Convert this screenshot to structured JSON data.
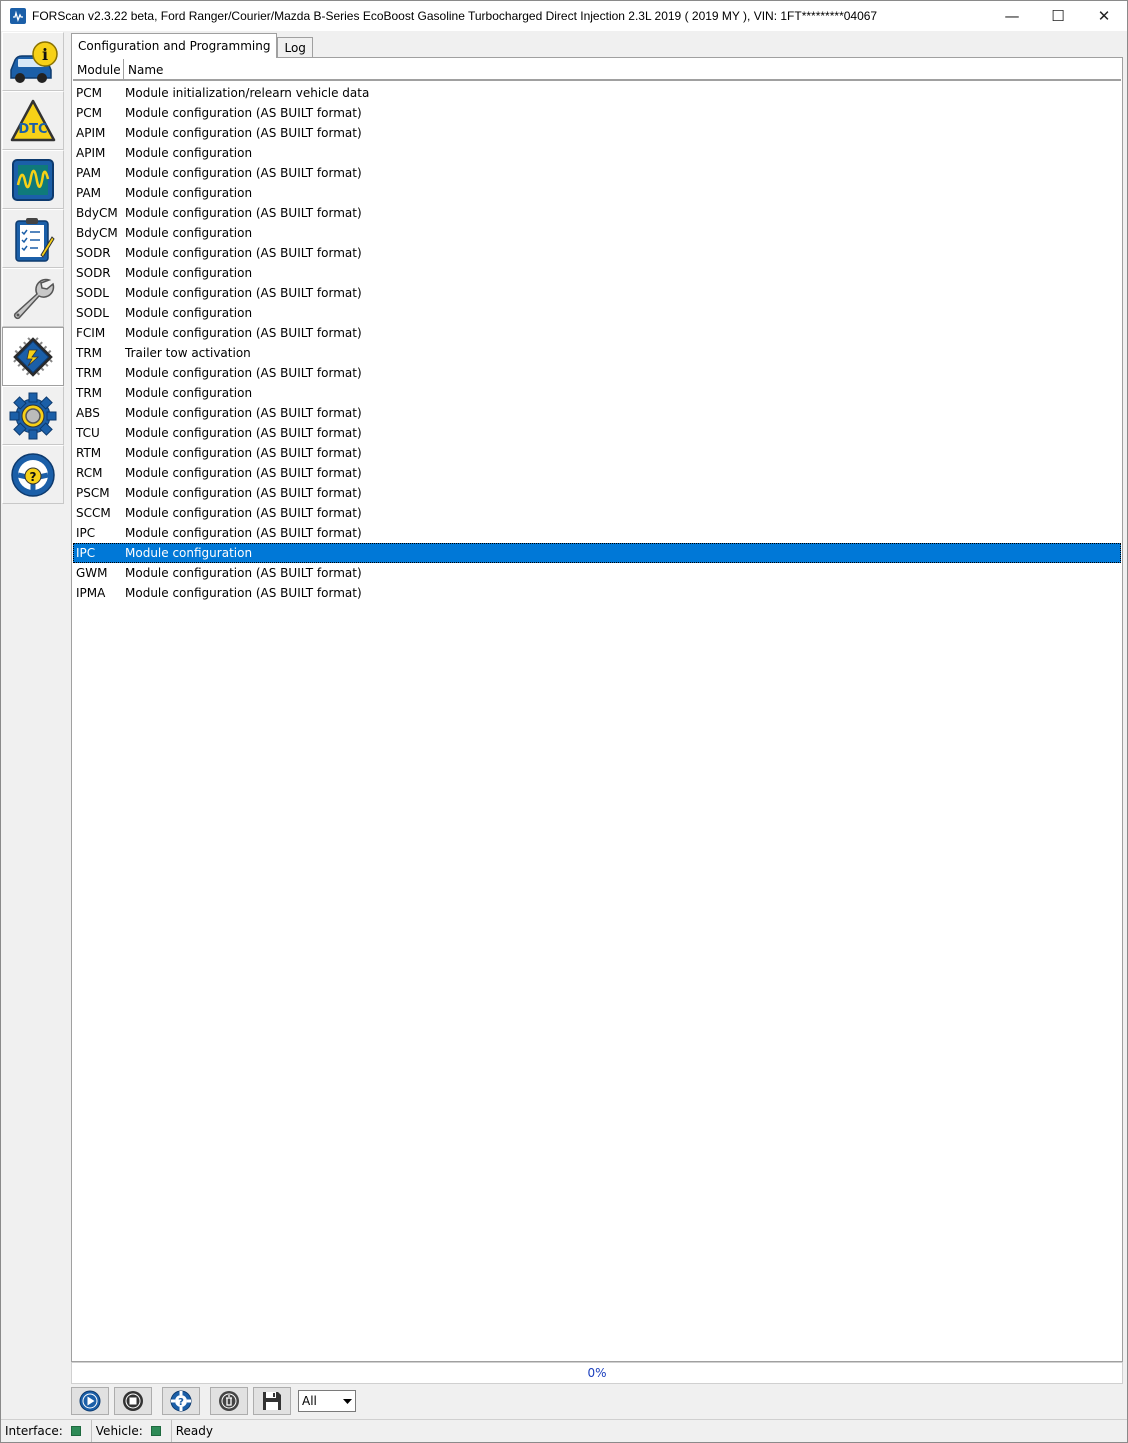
{
  "window": {
    "title": "FORScan v2.3.22 beta, Ford Ranger/Courier/Mazda B-Series EcoBoost Gasoline Turbocharged Direct Injection 2.3L 2019 ( 2019 MY ), VIN: 1FT*********04067",
    "minimize_glyph": "—",
    "maximize_glyph": "☐",
    "close_glyph": "✕"
  },
  "sidebar": {
    "items": [
      {
        "name": "vehicle-info",
        "icon": "car-info-icon"
      },
      {
        "name": "dtc",
        "icon": "dtc-warning-icon"
      },
      {
        "name": "oscilloscope",
        "icon": "oscilloscope-icon"
      },
      {
        "name": "tests",
        "icon": "checklist-icon"
      },
      {
        "name": "service",
        "icon": "wrench-icon"
      },
      {
        "name": "configuration",
        "icon": "chip-icon",
        "active": true
      },
      {
        "name": "settings",
        "icon": "gear-icon"
      },
      {
        "name": "help",
        "icon": "steering-help-icon"
      }
    ]
  },
  "tabs": [
    {
      "label": "Configuration and Programming",
      "active": true
    },
    {
      "label": "Log",
      "active": false
    }
  ],
  "table": {
    "columns": [
      "Module",
      "Name"
    ],
    "rows": [
      [
        "PCM",
        "Module initialization/relearn vehicle data"
      ],
      [
        "PCM",
        "Module configuration (AS BUILT format)"
      ],
      [
        "APIM",
        "Module configuration (AS BUILT format)"
      ],
      [
        "APIM",
        "Module configuration"
      ],
      [
        "PAM",
        "Module configuration (AS BUILT format)"
      ],
      [
        "PAM",
        "Module configuration"
      ],
      [
        "BdyCM",
        "Module configuration (AS BUILT format)"
      ],
      [
        "BdyCM",
        "Module configuration"
      ],
      [
        "SODR",
        "Module configuration (AS BUILT format)"
      ],
      [
        "SODR",
        "Module configuration"
      ],
      [
        "SODL",
        "Module configuration (AS BUILT format)"
      ],
      [
        "SODL",
        "Module configuration"
      ],
      [
        "FCIM",
        "Module configuration (AS BUILT format)"
      ],
      [
        "TRM",
        "Trailer tow activation"
      ],
      [
        "TRM",
        "Module configuration (AS BUILT format)"
      ],
      [
        "TRM",
        "Module configuration"
      ],
      [
        "ABS",
        "Module configuration (AS BUILT format)"
      ],
      [
        "TCU",
        "Module configuration (AS BUILT format)"
      ],
      [
        "RTM",
        "Module configuration (AS BUILT format)"
      ],
      [
        "RCM",
        "Module configuration (AS BUILT format)"
      ],
      [
        "PSCM",
        "Module configuration (AS BUILT format)"
      ],
      [
        "SCCM",
        "Module configuration (AS BUILT format)"
      ],
      [
        "IPC",
        "Module configuration (AS BUILT format)"
      ],
      [
        "IPC",
        "Module configuration"
      ],
      [
        "GWM",
        "Module configuration (AS BUILT format)"
      ],
      [
        "IPMA",
        "Module configuration (AS BUILT format)"
      ]
    ],
    "selected_row_index": 23
  },
  "progress": {
    "label": "0%",
    "value": 0
  },
  "toolbar": {
    "buttons": [
      "play-icon",
      "stop-icon",
      "help-lifebuoy-icon",
      "clear-icon",
      "save-icon"
    ],
    "filter": {
      "value": "All"
    }
  },
  "statusbar": {
    "interface_label": "Interface:",
    "vehicle_label": "Vehicle:",
    "status": "Ready"
  },
  "colors": {
    "selection": "#0078d7",
    "led_ok": "#2e8b57",
    "progress_text": "#1a3ebd",
    "icon_blue": "#1b5fa8",
    "icon_yellow": "#f7d117"
  }
}
